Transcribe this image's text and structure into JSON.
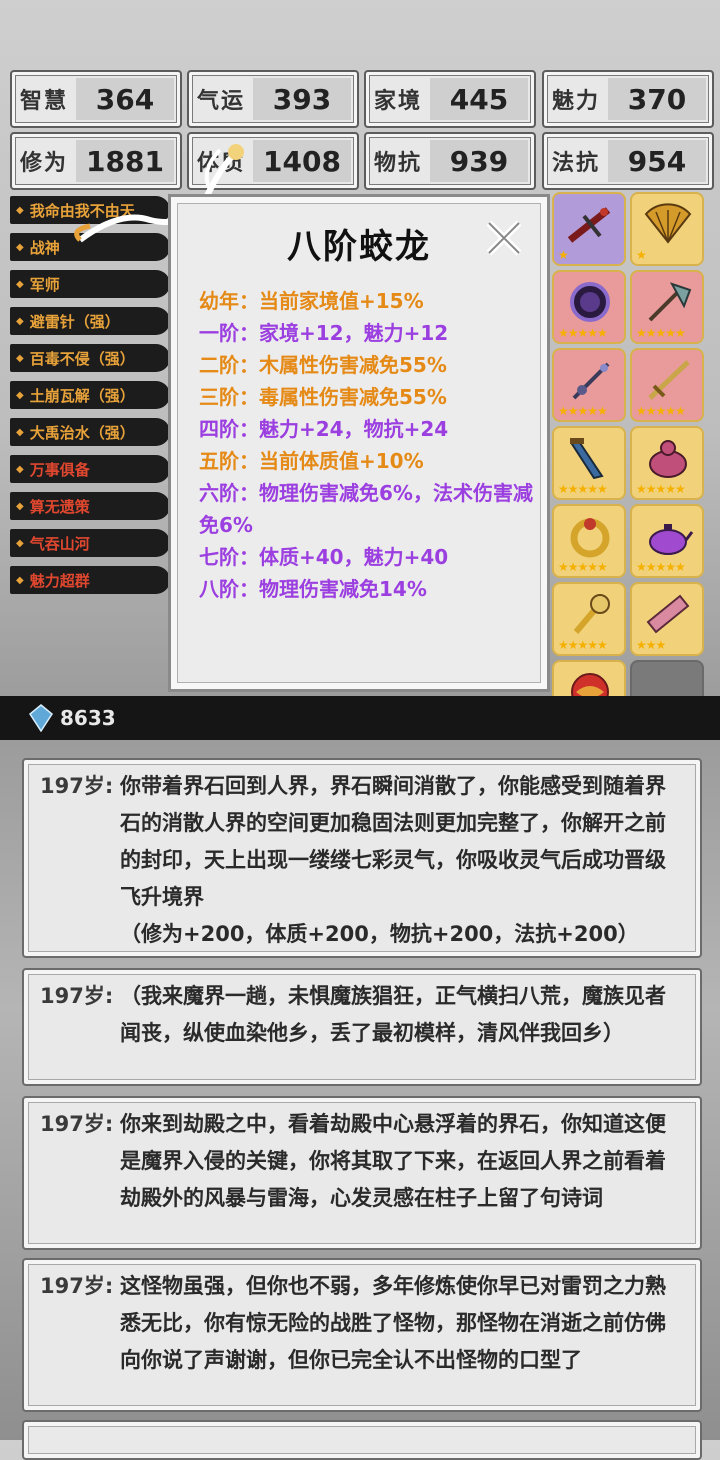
{
  "stats": [
    {
      "label": "智慧",
      "value": "364"
    },
    {
      "label": "气运",
      "value": "393"
    },
    {
      "label": "家境",
      "value": "445"
    },
    {
      "label": "魅力",
      "value": "370"
    },
    {
      "label": "修为",
      "value": "1881"
    },
    {
      "label": "体质",
      "value": "1408"
    },
    {
      "label": "物抗",
      "value": "939"
    },
    {
      "label": "法抗",
      "value": "954"
    }
  ],
  "skills": [
    {
      "label": "我命由我不由天",
      "color": "orange"
    },
    {
      "label": "战神",
      "color": "orange"
    },
    {
      "label": "军师",
      "color": "orange"
    },
    {
      "label": "避雷针（强）",
      "color": "orange"
    },
    {
      "label": "百毒不侵（强）",
      "color": "orange"
    },
    {
      "label": "土崩瓦解（强）",
      "color": "orange"
    },
    {
      "label": "大禹治水（强）",
      "color": "orange"
    },
    {
      "label": "万事俱备",
      "color": "red"
    },
    {
      "label": "算无遗策",
      "color": "red"
    },
    {
      "label": "气吞山河",
      "color": "red"
    },
    {
      "label": "魅力超群",
      "color": "red"
    }
  ],
  "gems": {
    "count": "8633",
    "icon": "crystal-icon"
  },
  "popup": {
    "title": "八阶蛟龙",
    "close_icon": "close-x-icon",
    "lines": [
      {
        "text": "幼年：当前家境值+15%",
        "color": "orange"
      },
      {
        "text": "一阶：家境+12，魅力+12",
        "color": "purple"
      },
      {
        "text": "二阶：木属性伤害减免55%",
        "color": "orange"
      },
      {
        "text": "三阶：毒属性伤害减免55%",
        "color": "orange"
      },
      {
        "text": "四阶：魅力+24，物抗+24",
        "color": "purple"
      },
      {
        "text": "五阶：当前体质值+10%",
        "color": "orange"
      },
      {
        "text": "六阶：物理伤害减免6%，法术伤害减免6%",
        "color": "purple"
      },
      {
        "text": "七阶：体质+40，魅力+40",
        "color": "purple"
      },
      {
        "text": "八阶：物理伤害减免14%",
        "color": "purple"
      }
    ]
  },
  "equipment": [
    {
      "name": "crossbow-icon",
      "rarity": "purple",
      "stars": "★"
    },
    {
      "name": "fan-icon",
      "rarity": "orange",
      "stars": "★"
    },
    {
      "name": "mirror-icon",
      "rarity": "red",
      "stars": "★★★★★"
    },
    {
      "name": "axe-icon",
      "rarity": "red",
      "stars": "★★★★★"
    },
    {
      "name": "staff-icon",
      "rarity": "red",
      "stars": "★★★★★"
    },
    {
      "name": "sword-icon",
      "rarity": "red",
      "stars": "★★★★★"
    },
    {
      "name": "dagger-icon",
      "rarity": "orange",
      "stars": "★★★★★"
    },
    {
      "name": "gourd-icon",
      "rarity": "orange",
      "stars": "★★★★★"
    },
    {
      "name": "ring-icon",
      "rarity": "orange",
      "stars": "★★★★★"
    },
    {
      "name": "teapot-icon",
      "rarity": "orange",
      "stars": "★★★★★"
    },
    {
      "name": "scepter-icon",
      "rarity": "orange",
      "stars": "★★★★★"
    },
    {
      "name": "scroll-icon",
      "rarity": "orange",
      "stars": "★★★"
    },
    {
      "name": "orb-icon",
      "rarity": "orange",
      "stars": "★"
    },
    {
      "name": "empty-slot",
      "rarity": "empty",
      "stars": ""
    }
  ],
  "logs": [
    {
      "age": "197岁:",
      "text": "你带着界石回到人界，界石瞬间消散了，你能感受到随着界石的消散人界的空间更加稳固法则更加完整了，你解开之前的封印，天上出现一缕缕七彩灵气，你吸收灵气后成功晋级飞升境界",
      "extra": "（修为+200，体质+200，物抗+200，法抗+200）"
    },
    {
      "age": "197岁:",
      "text": "（我来魔界一趟，未惧魔族猖狂，正气横扫八荒，魔族见者闻丧，纵使血染他乡，丢了最初模样，清风伴我回乡）",
      "extra": ""
    },
    {
      "age": "197岁:",
      "text": "你来到劫殿之中，看着劫殿中心悬浮着的界石，你知道这便是魔界入侵的关键，你将其取了下来，在返回人界之前看着劫殿外的风暴与雷海，心发灵感在柱子上留了句诗词",
      "extra": ""
    },
    {
      "age": "197岁:",
      "text": "这怪物虽强，但你也不弱，多年修炼使你早已对雷罚之力熟悉无比，你有惊无险的战胜了怪物，那怪物在消逝之前仿佛向你说了声谢谢，但你已完全认不出怪物的口型了",
      "extra": ""
    }
  ]
}
